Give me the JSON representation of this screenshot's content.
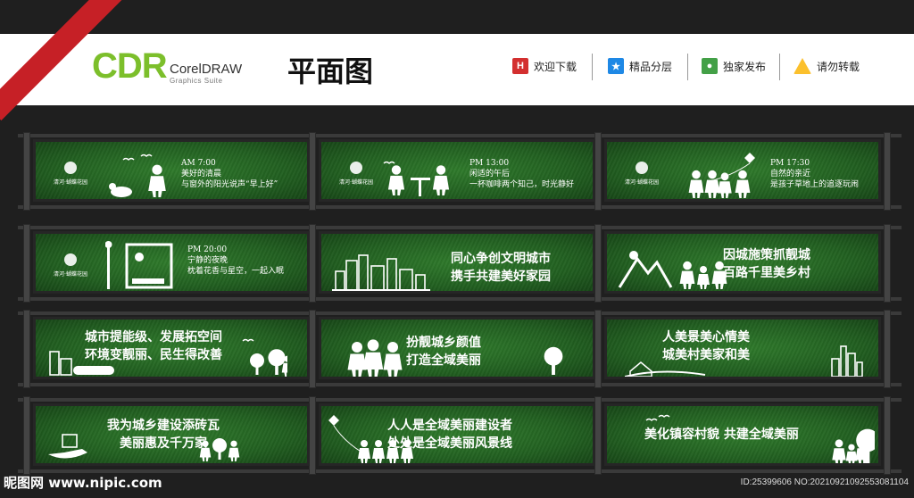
{
  "header": {
    "logo_mark": "CDR",
    "logo_name": "CorelDRAW",
    "logo_sub": "Graphics Suite",
    "title": "平面图",
    "items": [
      {
        "icon": "h-icon",
        "glyph": "H",
        "label": "欢迎下载",
        "color": "#d32f2f"
      },
      {
        "icon": "star-icon",
        "glyph": "★",
        "label": "精品分层",
        "color": "#1e88e5"
      },
      {
        "icon": "person-icon",
        "glyph": "●",
        "label": "独家发布",
        "color": "#43a047"
      },
      {
        "icon": "warning-icon",
        "glyph": "!",
        "label": "请勿转载",
        "color": "#fbc02d"
      }
    ]
  },
  "brand_text": "清河·蝴蝶花园",
  "panels": [
    {
      "lines": [
        "AM  7:00",
        "美好的清晨",
        "与窗外的阳光说声“早上好”"
      ]
    },
    {
      "lines": [
        "PM  13:00",
        "闲适的午后",
        "一杯咖啡两个知己，时光静好"
      ]
    },
    {
      "lines": [
        "PM  17:30",
        "自然的亲近",
        "是孩子草地上的追逐玩闹"
      ]
    },
    {
      "lines": [
        "PM  20:00",
        "宁静的夜晚",
        "枕着花香与星空，一起入眠"
      ]
    },
    {
      "lines": [
        "同心争创文明城市",
        "携手共建美好家园"
      ]
    },
    {
      "lines": [
        "因城施策抓靓城",
        "百路千里美乡村"
      ]
    },
    {
      "lines": [
        "城市提能级、发展拓空间",
        "环境变靓丽、民生得改善"
      ]
    },
    {
      "lines": [
        "扮靓城乡颜值",
        "打造全域美丽"
      ]
    },
    {
      "lines": [
        "人美景美心情美",
        "城美村美家和美"
      ]
    },
    {
      "lines": [
        "我为城乡建设添砖瓦",
        "美丽惠及千万家"
      ]
    },
    {
      "lines": [
        "人人是全域美丽建设者",
        "处处是全域美丽风景线"
      ]
    },
    {
      "lines": [
        "美化镇容村貌  共建全域美丽"
      ]
    }
  ],
  "footer": {
    "watermark": "昵图网 www.nipic.com",
    "id_text": "ID:25399606 NO:20210921092553081104"
  }
}
